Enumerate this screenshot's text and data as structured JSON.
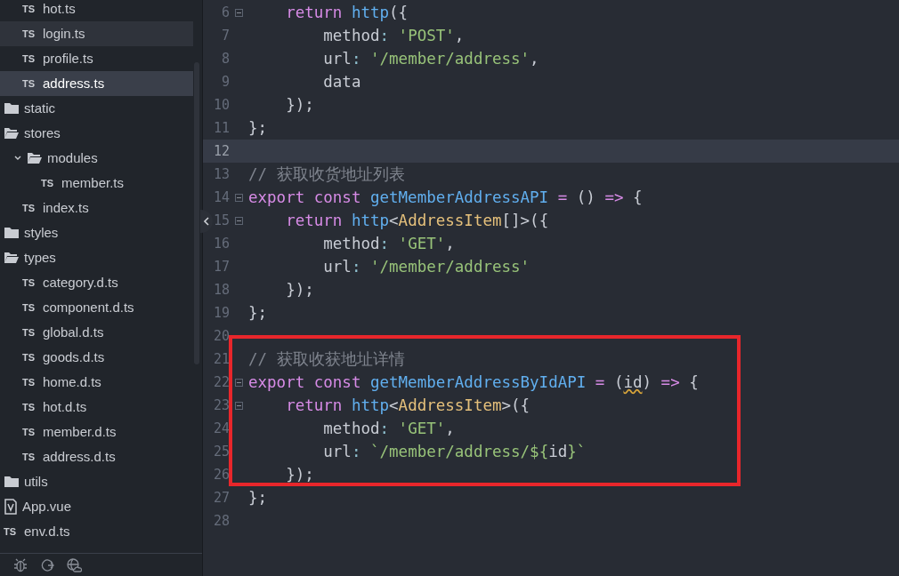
{
  "tree": [
    {
      "children": [
        {
          "kind": "ts",
          "badge": "TS",
          "label": "hot.ts",
          "selected": false,
          "hovered": false
        },
        {
          "kind": "ts",
          "badge": "TS",
          "label": "login.ts",
          "selected": false,
          "hovered": true
        },
        {
          "kind": "ts",
          "badge": "TS",
          "label": "profile.ts",
          "selected": false,
          "hovered": false
        },
        {
          "kind": "ts",
          "badge": "TS",
          "label": "address.ts",
          "selected": true,
          "hovered": false
        }
      ]
    },
    {
      "kind": "folder",
      "label": "static",
      "expanded": false,
      "toggle": false
    },
    {
      "kind": "folder",
      "label": "stores",
      "expanded": true,
      "toggle": false,
      "children": [
        {
          "kind": "folder",
          "label": "modules",
          "expanded": true,
          "toggle": true,
          "children": [
            {
              "kind": "ts",
              "badge": "TS",
              "label": "member.ts",
              "selected": false,
              "hovered": false
            }
          ]
        },
        {
          "kind": "ts",
          "badge": "TS",
          "label": "index.ts",
          "selected": false,
          "hovered": false
        }
      ]
    },
    {
      "kind": "folder",
      "label": "styles",
      "expanded": false,
      "toggle": false
    },
    {
      "kind": "folder",
      "label": "types",
      "expanded": true,
      "toggle": false,
      "children": [
        {
          "kind": "ts",
          "badge": "TS",
          "label": "category.d.ts",
          "selected": false,
          "hovered": false
        },
        {
          "kind": "ts",
          "badge": "TS",
          "label": "component.d.ts",
          "selected": false,
          "hovered": false
        },
        {
          "kind": "ts",
          "badge": "TS",
          "label": "global.d.ts",
          "selected": false,
          "hovered": false
        },
        {
          "kind": "ts",
          "badge": "TS",
          "label": "goods.d.ts",
          "selected": false,
          "hovered": false
        },
        {
          "kind": "ts",
          "badge": "TS",
          "label": "home.d.ts",
          "selected": false,
          "hovered": false
        },
        {
          "kind": "ts",
          "badge": "TS",
          "label": "hot.d.ts",
          "selected": false,
          "hovered": false
        },
        {
          "kind": "ts",
          "badge": "TS",
          "label": "member.d.ts",
          "selected": false,
          "hovered": false
        },
        {
          "kind": "ts",
          "badge": "TS",
          "label": "address.d.ts",
          "selected": false,
          "hovered": false
        }
      ]
    },
    {
      "kind": "folder",
      "label": "utils",
      "expanded": false,
      "toggle": false
    },
    {
      "kind": "vue",
      "label": "App.vue",
      "selected": false,
      "hovered": false
    },
    {
      "kind": "ts",
      "badge": "TS",
      "label": "env.d.ts",
      "selected": false,
      "hovered": false
    }
  ],
  "editor": {
    "lines": [
      {
        "number": "6",
        "fold": true,
        "current": false,
        "tokens": [
          {
            "kind": "keyword",
            "text": "    return "
          },
          {
            "kind": "func",
            "text": "http"
          },
          {
            "kind": "plain",
            "text": "({"
          }
        ]
      },
      {
        "number": "7",
        "fold": false,
        "current": false,
        "tokens": [
          {
            "kind": "plain",
            "text": "        method"
          },
          {
            "kind": "colon",
            "text": ": "
          },
          {
            "kind": "string",
            "text": "'POST'"
          },
          {
            "kind": "plain",
            "text": ","
          }
        ]
      },
      {
        "number": "8",
        "fold": false,
        "current": false,
        "tokens": [
          {
            "kind": "plain",
            "text": "        url"
          },
          {
            "kind": "colon",
            "text": ": "
          },
          {
            "kind": "string",
            "text": "'/member/address'"
          },
          {
            "kind": "plain",
            "text": ","
          }
        ]
      },
      {
        "number": "9",
        "fold": false,
        "current": false,
        "tokens": [
          {
            "kind": "plain",
            "text": "        data"
          }
        ]
      },
      {
        "number": "10",
        "fold": false,
        "current": false,
        "tokens": [
          {
            "kind": "plain",
            "text": "    });"
          }
        ]
      },
      {
        "number": "11",
        "fold": false,
        "current": false,
        "tokens": [
          {
            "kind": "plain",
            "text": "};"
          }
        ]
      },
      {
        "number": "12",
        "fold": false,
        "current": true
      },
      {
        "number": "13",
        "fold": false,
        "current": false,
        "tokens": [
          {
            "kind": "comment",
            "text": "// 获取收货地址列表"
          }
        ]
      },
      {
        "number": "14",
        "fold": true,
        "current": false,
        "tokens": [
          {
            "kind": "keyword",
            "text": "export const "
          },
          {
            "kind": "func",
            "text": "getMemberAddressAPI"
          },
          {
            "kind": "operator",
            "text": " = "
          },
          {
            "kind": "plain",
            "text": "() "
          },
          {
            "kind": "operator",
            "text": "=> "
          },
          {
            "kind": "plain",
            "text": "{"
          }
        ]
      },
      {
        "number": "15",
        "fold": true,
        "current": false,
        "tokens": [
          {
            "kind": "keyword",
            "text": "    return "
          },
          {
            "kind": "func",
            "text": "http"
          },
          {
            "kind": "plain",
            "text": "<"
          },
          {
            "kind": "type",
            "text": "AddressItem"
          },
          {
            "kind": "plain",
            "text": "[]>({"
          }
        ]
      },
      {
        "number": "16",
        "fold": false,
        "current": false,
        "tokens": [
          {
            "kind": "plain",
            "text": "        method"
          },
          {
            "kind": "colon",
            "text": ": "
          },
          {
            "kind": "string",
            "text": "'GET'"
          },
          {
            "kind": "plain",
            "text": ","
          }
        ]
      },
      {
        "number": "17",
        "fold": false,
        "current": false,
        "tokens": [
          {
            "kind": "plain",
            "text": "        url"
          },
          {
            "kind": "colon",
            "text": ": "
          },
          {
            "kind": "string",
            "text": "'/member/address'"
          }
        ]
      },
      {
        "number": "18",
        "fold": false,
        "current": false,
        "tokens": [
          {
            "kind": "plain",
            "text": "    });"
          }
        ]
      },
      {
        "number": "19",
        "fold": false,
        "current": false,
        "tokens": [
          {
            "kind": "plain",
            "text": "};"
          }
        ]
      },
      {
        "number": "20",
        "fold": false,
        "current": false
      },
      {
        "number": "21",
        "fold": false,
        "current": false,
        "highlighted": true,
        "tokens": [
          {
            "kind": "comment",
            "text": "// 获取收获地址详情"
          }
        ]
      },
      {
        "number": "22",
        "fold": true,
        "current": false,
        "highlighted": true,
        "tokens": [
          {
            "kind": "keyword",
            "text": "export const "
          },
          {
            "kind": "func",
            "text": "getMemberAddressByIdAPI"
          },
          {
            "kind": "operator",
            "text": " = "
          },
          {
            "kind": "plain",
            "text": "("
          },
          {
            "kind": "warning",
            "text": "id"
          },
          {
            "kind": "plain",
            "text": ") "
          },
          {
            "kind": "operator",
            "text": "=> "
          },
          {
            "kind": "plain",
            "text": "{"
          }
        ]
      },
      {
        "number": "23",
        "fold": true,
        "current": false,
        "highlighted": true,
        "tokens": [
          {
            "kind": "keyword",
            "text": "    return "
          },
          {
            "kind": "func",
            "text": "http"
          },
          {
            "kind": "plain",
            "text": "<"
          },
          {
            "kind": "type",
            "text": "AddressItem"
          },
          {
            "kind": "plain",
            "text": ">({"
          }
        ]
      },
      {
        "number": "24",
        "fold": false,
        "current": false,
        "highlighted": true,
        "tokens": [
          {
            "kind": "plain",
            "text": "        method"
          },
          {
            "kind": "colon",
            "text": ": "
          },
          {
            "kind": "string",
            "text": "'GET'"
          },
          {
            "kind": "plain",
            "text": ","
          }
        ]
      },
      {
        "number": "25",
        "fold": false,
        "current": false,
        "highlighted": true,
        "tokens": [
          {
            "kind": "plain",
            "text": "        url"
          },
          {
            "kind": "colon",
            "text": ": "
          },
          {
            "kind": "string",
            "text": "`/member/address/${"
          },
          {
            "kind": "plain",
            "text": "id"
          },
          {
            "kind": "string",
            "text": "}`"
          }
        ]
      },
      {
        "number": "26",
        "fold": false,
        "current": false,
        "highlighted": true,
        "tokens": [
          {
            "kind": "plain",
            "text": "    });"
          }
        ]
      },
      {
        "number": "27",
        "fold": false,
        "current": false,
        "tokens": [
          {
            "kind": "plain",
            "text": "};"
          }
        ]
      },
      {
        "number": "28",
        "fold": false,
        "current": false
      }
    ]
  }
}
